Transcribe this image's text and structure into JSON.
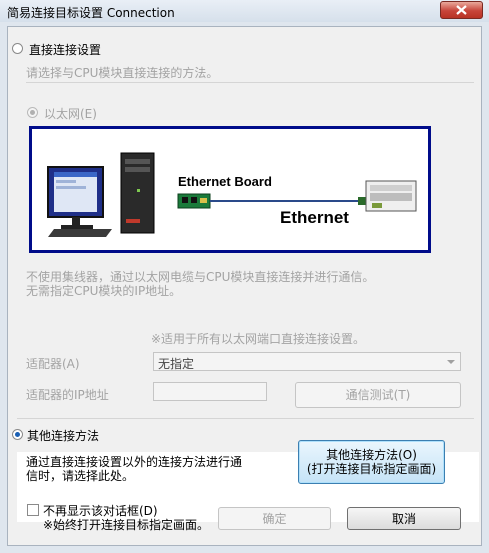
{
  "window": {
    "title": "简易连接目标设置 Connection"
  },
  "direct": {
    "label": "直接连接设置",
    "description": "请选择与CPU模块直接连接的方法。",
    "ethernet_label": "以太网(E)",
    "diagram": {
      "board_label": "Ethernet Board",
      "network_label": "Ethernet"
    },
    "note_line1": "不使用集线器，通过以太网电缆与CPU模块直接连接并进行通信。",
    "note_line2": "无需指定CPU模块的IP地址。",
    "applies_note": "※适用于所有以太网端口直接连接设置。",
    "adapter_label": "适配器(A)",
    "adapter_value": "无指定",
    "ip_label": "适配器的IP地址",
    "ip_value": "",
    "test_button": "通信测试(T)"
  },
  "other": {
    "label": "其他连接方法",
    "description_line1": "通过直接连接设置以外的连接方法进行通",
    "description_line2": "信时，请选择此处。",
    "button_line1": "其他连接方法(O)",
    "button_line2": "(打开连接目标指定画面)"
  },
  "footer": {
    "checkbox_line1": "不再显示该对话框(D)",
    "checkbox_line2": "※始终打开连接目标指定画面。",
    "ok_button": "确定",
    "cancel_button": "取消"
  },
  "colors": {
    "diagram_border": "#000c8a",
    "selection": "#1a5fb4"
  }
}
